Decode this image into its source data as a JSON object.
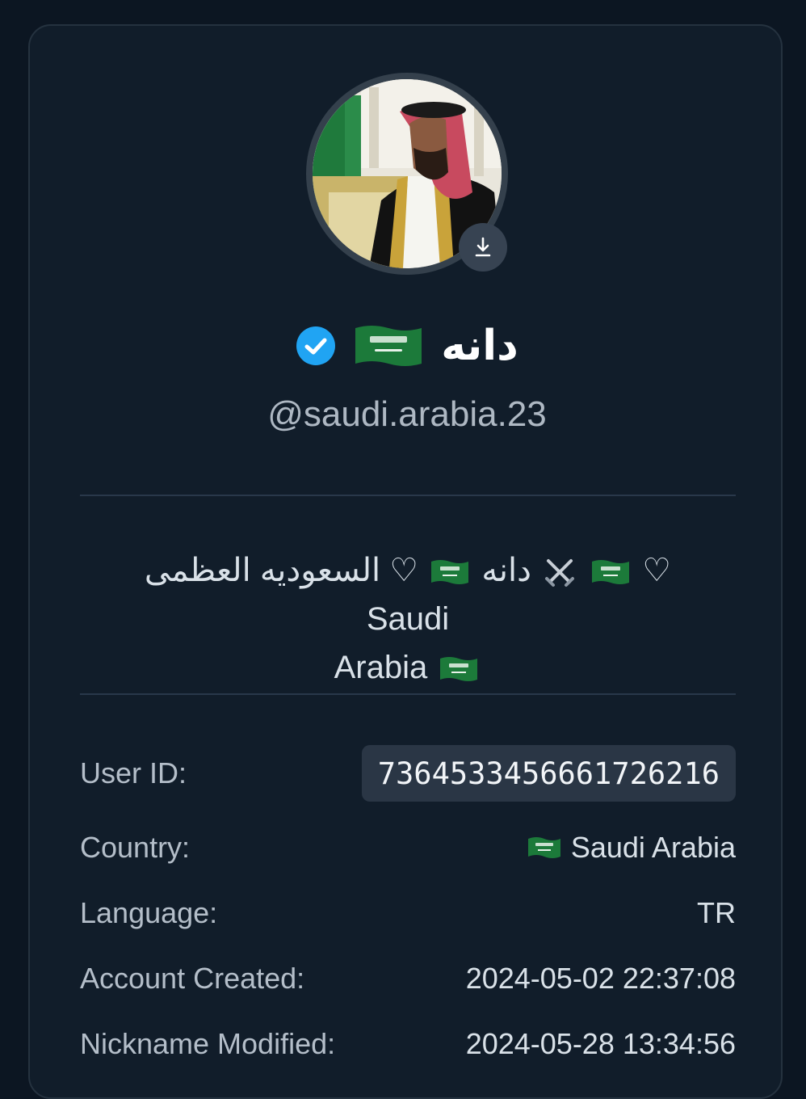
{
  "profile": {
    "display_name": "دانه",
    "name_flag_icon": "saudi-flag-icon",
    "verified_icon": "verified-badge-icon",
    "username": "@saudi.arabia.23",
    "download_icon": "download-icon"
  },
  "bio": {
    "line1_latin": "Saudi",
    "line1_heart1": "♡",
    "line1_arabic1": "السعوديه العظمى",
    "line1_heart2": "♡",
    "line1_arabic2": "دانه",
    "line2_latin": "Arabia",
    "swords_icon": "crossed-swords-icon"
  },
  "info": {
    "user_id_label": "User ID:",
    "user_id_value": "7364533456661726216",
    "country_label": "Country:",
    "country_value": "Saudi Arabia",
    "language_label": "Language:",
    "language_value": "TR",
    "created_label": "Account Created:",
    "created_value": "2024-05-02 22:37:08",
    "nickname_label": "Nickname Modified:",
    "nickname_value": "2024-05-28 13:34:56"
  },
  "colors": {
    "background": "#0c1622",
    "card": "#111d2a",
    "verified": "#20a4f3",
    "flag_green": "#1c7a3a"
  }
}
